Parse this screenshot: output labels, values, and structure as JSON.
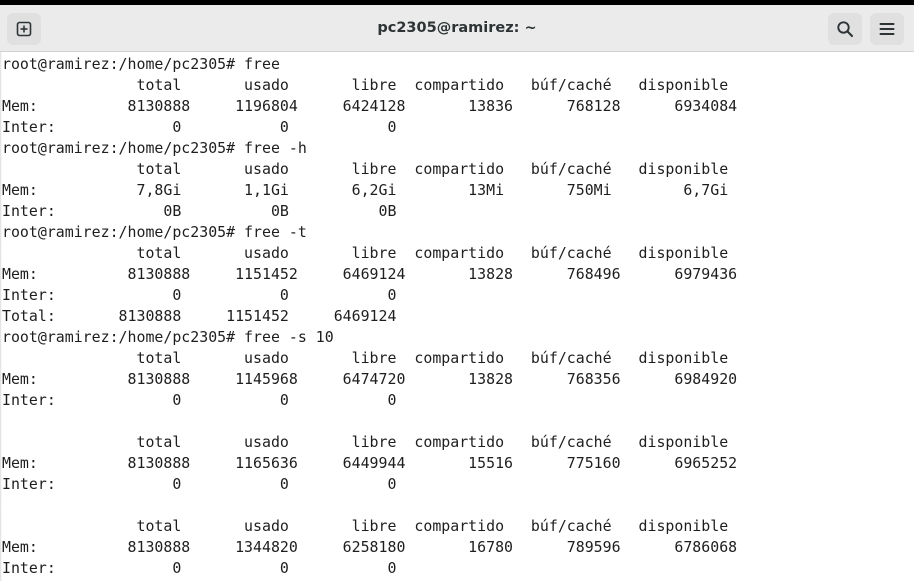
{
  "window": {
    "title": "pc2305@ramirez: ~"
  },
  "icons": {
    "new_tab": "new-tab-icon",
    "search": "search-icon",
    "menu": "hamburger-menu-icon"
  },
  "colors": {
    "headerbar_bg": "#ebebeb",
    "terminal_bg": "#ffffff",
    "text": "#1e1e1e"
  },
  "terminal": {
    "lines": [
      "root@ramirez:/home/pc2305# free",
      "               total       usado       libre  compartido   búf/caché   disponible",
      "Mem:          8130888     1196804     6424128       13836      768128      6934084",
      "Inter:             0           0           0",
      "root@ramirez:/home/pc2305# free -h",
      "               total       usado       libre  compartido   búf/caché   disponible",
      "Mem:           7,8Gi       1,1Gi       6,2Gi        13Mi       750Mi        6,7Gi",
      "Inter:            0B          0B          0B",
      "root@ramirez:/home/pc2305# free -t",
      "               total       usado       libre  compartido   búf/caché   disponible",
      "Mem:          8130888     1151452     6469124       13828      768496      6979436",
      "Inter:             0           0           0",
      "Total:       8130888     1151452     6469124",
      "root@ramirez:/home/pc2305# free -s 10",
      "               total       usado       libre  compartido   búf/caché   disponible",
      "Mem:          8130888     1145968     6474720       13828      768356      6984920",
      "Inter:             0           0           0",
      "",
      "               total       usado       libre  compartido   búf/caché   disponible",
      "Mem:          8130888     1165636     6449944       15516      775160      6965252",
      "Inter:             0           0           0",
      "",
      "               total       usado       libre  compartido   búf/caché   disponible",
      "Mem:          8130888     1344820     6258180       16780      789596      6786068",
      "Inter:             0           0           0"
    ]
  }
}
